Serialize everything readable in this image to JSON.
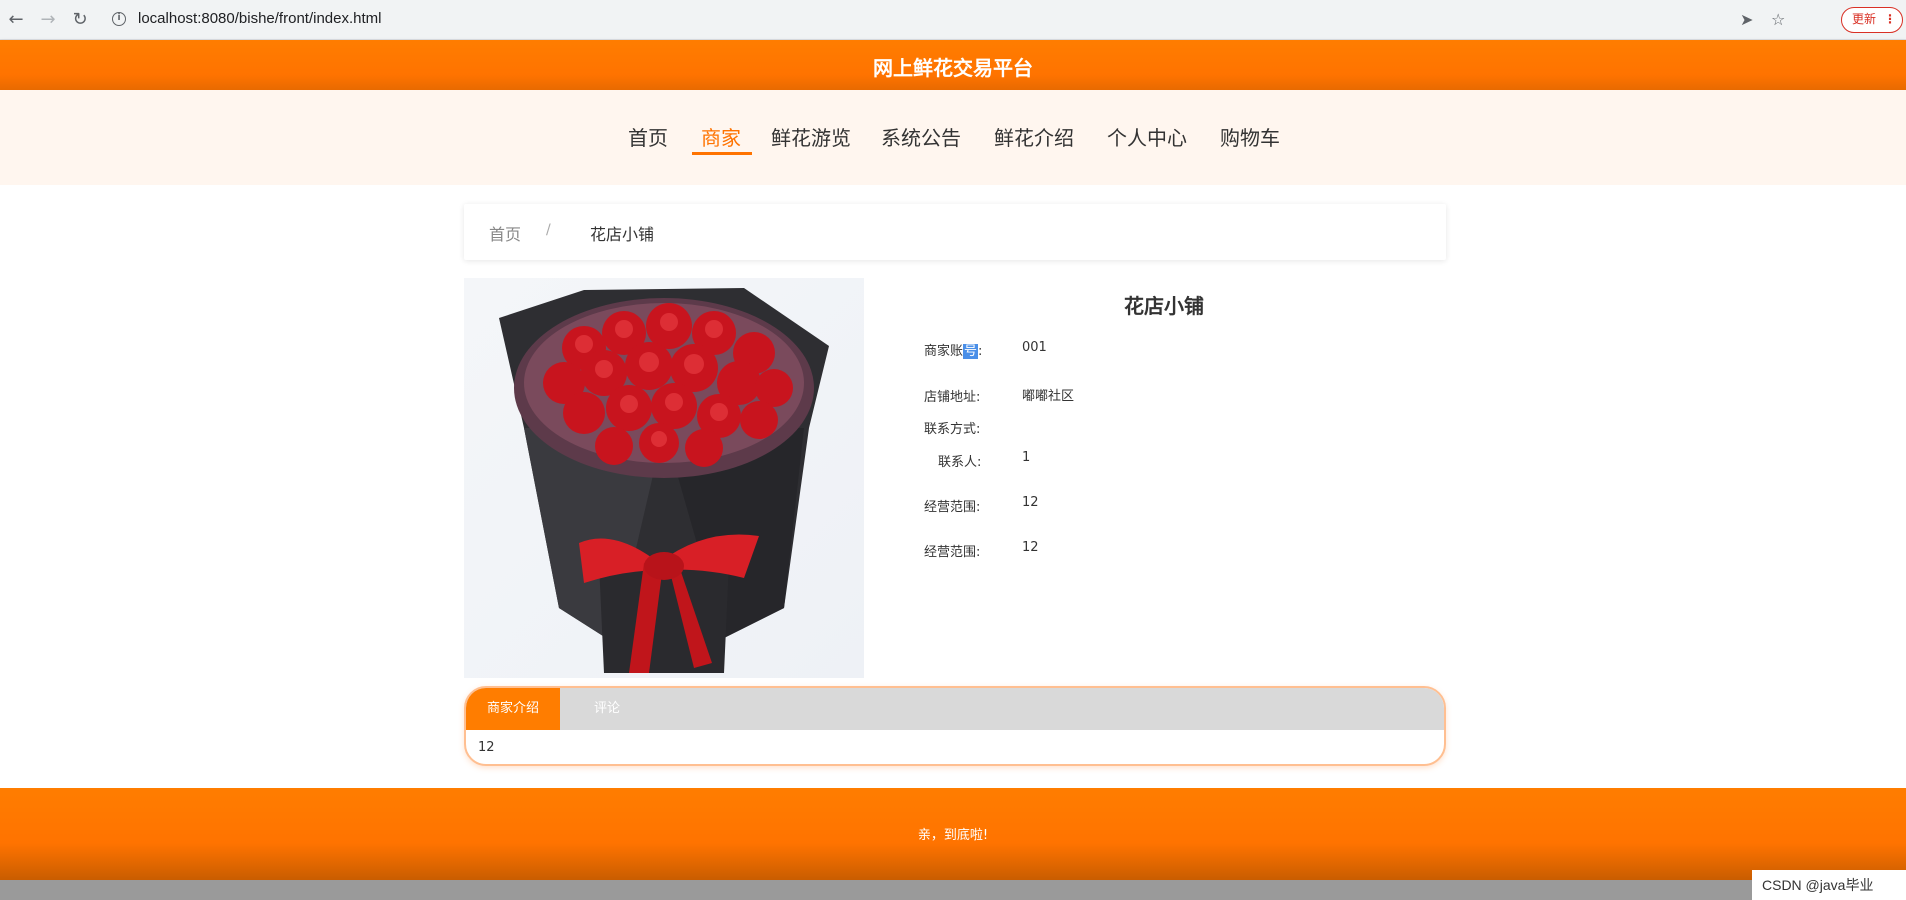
{
  "browser": {
    "url": "localhost:8080/bishe/front/index.html",
    "update_label": "更新"
  },
  "header": {
    "title": "网上鲜花交易平台"
  },
  "nav": {
    "items": [
      "首页",
      "商家",
      "鲜花游览",
      "系统公告",
      "鲜花介绍",
      "个人中心",
      "购物车"
    ],
    "active": "商家"
  },
  "breadcrumb": {
    "home": "首页",
    "separator": "/",
    "current": "花店小铺"
  },
  "shop": {
    "name": "花店小铺",
    "account_label_a": "商家账",
    "account_label_b": "号",
    "account_label_c": ":",
    "account_value": "001",
    "address_label": "店铺地址:",
    "address_value": "嘟嘟社区",
    "contact_label": "联系方式:",
    "contact_value": "",
    "person_label": "联系人:",
    "person_value": "1",
    "scope_label_1": "经营范围:",
    "scope_value_1": "12",
    "scope_label_2": "经营范围:",
    "scope_value_2": "12"
  },
  "tabs": {
    "items": [
      "商家介绍",
      "评论"
    ],
    "active": "商家介绍",
    "content": "12"
  },
  "footer": {
    "text": "亲，到底啦!"
  },
  "watermark": "CSDN @java毕业",
  "colors": {
    "brand": "#ff7d00",
    "nav_bg": "#fff6ef",
    "tab_inactive": "#d9d9d9"
  }
}
